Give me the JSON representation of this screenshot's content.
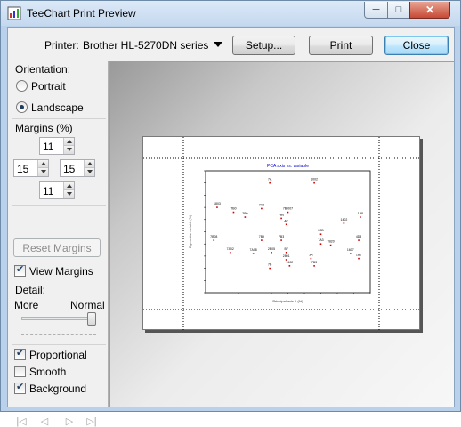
{
  "window": {
    "title": "TeeChart Print Preview"
  },
  "toolbar": {
    "printer_label": "Printer:",
    "printer_value": "Brother HL-5270DN series",
    "setup_label": "Setup...",
    "print_label": "Print",
    "close_label": "Close"
  },
  "orientation": {
    "label": "Orientation:",
    "portrait": "Portrait",
    "landscape": "Landscape",
    "selected": "Landscape"
  },
  "margins": {
    "label": "Margins (%)",
    "top": "11",
    "left": "15",
    "right": "15",
    "bottom": "11",
    "reset_label": "Reset Margins",
    "view_margins_label": "View Margins",
    "view_margins_checked": true
  },
  "detail": {
    "label": "Detail:",
    "more_label": "More",
    "normal_label": "Normal",
    "level": 1.0
  },
  "options": {
    "proportional_label": "Proportional",
    "proportional_checked": true,
    "smooth_label": "Smooth",
    "smooth_checked": false,
    "background_label": "Background",
    "background_checked": true
  },
  "nav_icons": [
    "first-page-icon",
    "prev-page-icon",
    "next-page-icon",
    "last-page-icon"
  ],
  "colors": {
    "accent": "#3c7fb1",
    "chart_title": "#0000cc",
    "point_marker": "#cc0000"
  },
  "chart_data": {
    "type": "scatter",
    "title": "PCA axis vs. variable",
    "xlabel": "Principal axis 1 (%)",
    "ylabel": "Eigenvalue variable (%)",
    "xlim": [
      0,
      10
    ],
    "ylim": [
      0,
      10
    ],
    "points": [
      {
        "label": "7A",
        "x": 3.9,
        "y": 9.0
      },
      {
        "label": "1002",
        "x": 6.6,
        "y": 9.0
      },
      {
        "label": "1803",
        "x": 0.7,
        "y": 7.0
      },
      {
        "label": "7B0",
        "x": 1.7,
        "y": 6.6
      },
      {
        "label": "7A8",
        "x": 3.4,
        "y": 6.9
      },
      {
        "label": "7B-007",
        "x": 5.0,
        "y": 6.6
      },
      {
        "label": "2B0",
        "x": 2.4,
        "y": 6.2
      },
      {
        "label": "7B6",
        "x": 4.6,
        "y": 6.1
      },
      {
        "label": "1B8",
        "x": 9.4,
        "y": 6.2
      },
      {
        "label": "1402",
        "x": 8.4,
        "y": 5.7
      },
      {
        "label": "4C",
        "x": 4.9,
        "y": 5.6
      },
      {
        "label": "20B",
        "x": 7.0,
        "y": 4.8
      },
      {
        "label": "7B08",
        "x": 0.5,
        "y": 4.3
      },
      {
        "label": "7B9",
        "x": 3.4,
        "y": 4.3
      },
      {
        "label": "7B3",
        "x": 4.6,
        "y": 4.3
      },
      {
        "label": "7A3",
        "x": 7.0,
        "y": 4.0
      },
      {
        "label": "7B20",
        "x": 7.6,
        "y": 3.9
      },
      {
        "label": "4D8",
        "x": 9.3,
        "y": 4.3
      },
      {
        "label": "7A02",
        "x": 1.5,
        "y": 3.3
      },
      {
        "label": "7A08",
        "x": 2.9,
        "y": 3.2
      },
      {
        "label": "2B05",
        "x": 4.0,
        "y": 3.3
      },
      {
        "label": "B7",
        "x": 4.9,
        "y": 3.3
      },
      {
        "label": "2801",
        "x": 4.9,
        "y": 2.7
      },
      {
        "label": "3A",
        "x": 6.4,
        "y": 2.8
      },
      {
        "label": "1607",
        "x": 8.8,
        "y": 3.2
      },
      {
        "label": "1B2",
        "x": 9.3,
        "y": 2.8
      },
      {
        "label": "1402",
        "x": 5.1,
        "y": 2.2
      },
      {
        "label": "7B3",
        "x": 6.6,
        "y": 2.2
      },
      {
        "label": "7B",
        "x": 3.9,
        "y": 2.0
      }
    ]
  }
}
